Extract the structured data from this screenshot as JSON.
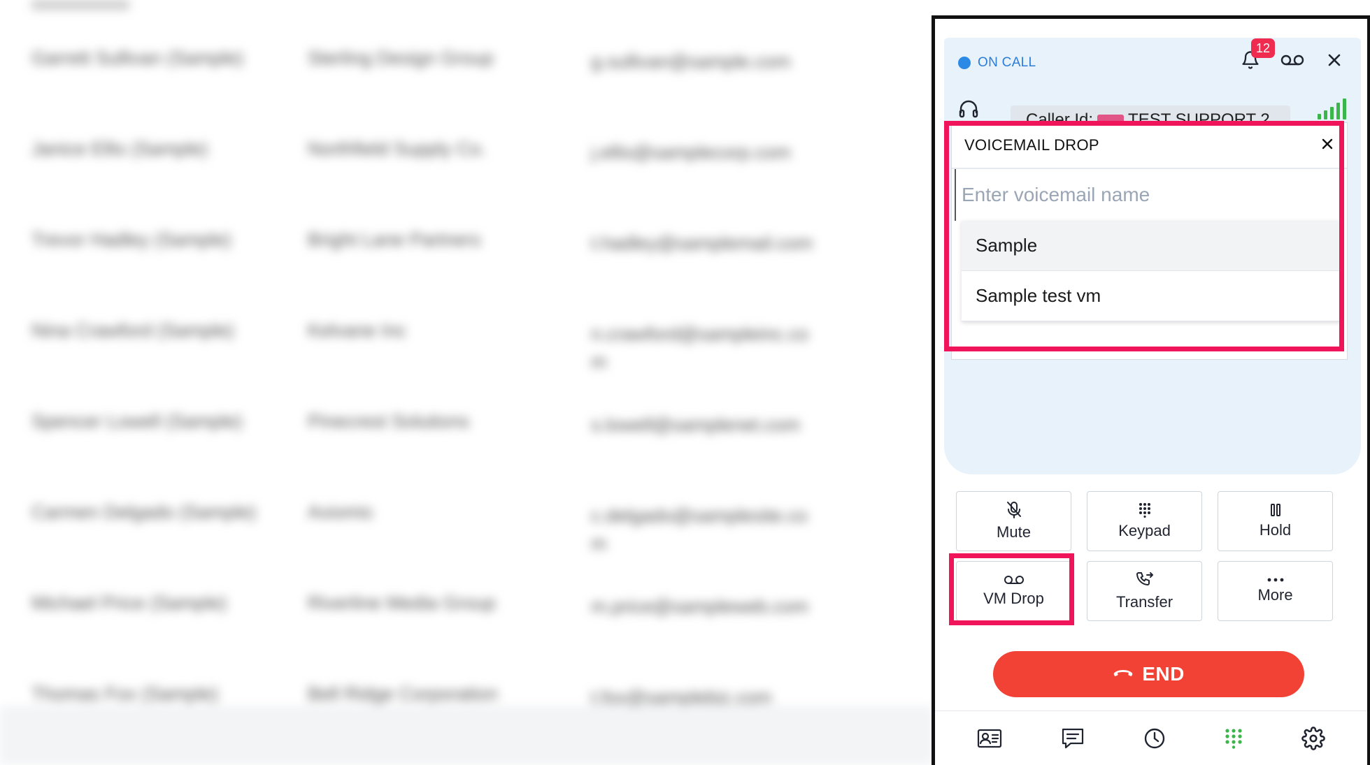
{
  "background": {
    "rows": [
      {
        "name": "Garrett Sullivan (Sample)",
        "company": "Sterling Design Group",
        "email": "g.sullivan@sample.com"
      },
      {
        "name": "Janice Ellis (Sample)",
        "company": "Northfield Supply Co.",
        "email": "j.ellis@samplecorp.com"
      },
      {
        "name": "Trevor Hadley (Sample)",
        "company": "Bright Lane Partners",
        "email": "t.hadley@samplemail.com"
      },
      {
        "name": "Nina Crawford (Sample)",
        "company": "Kelvane Inc",
        "email": "n.crawford@sampleinc.com"
      },
      {
        "name": "Spencer Lowell (Sample)",
        "company": "Pinecrest Solutions",
        "email": "s.lowell@samplenet.com"
      },
      {
        "name": "Carmen Delgado (Sample)",
        "company": "Axiomic",
        "email": "c.delgado@samplesite.com"
      },
      {
        "name": "Michael Price (Sample)",
        "company": "Riverline Media Group",
        "email": "m.price@sampleweb.com"
      },
      {
        "name": "Thomas Fox (Sample)",
        "company": "Bell Ridge Corporation",
        "email": "t.fox@samplebiz.com"
      }
    ]
  },
  "dialer": {
    "status": "ON CALL",
    "notifications_count": "12",
    "caller_id_label": "Caller Id:",
    "caller_name": "TEST SUPPORT 2",
    "voicemail_drop": {
      "title": "VOICEMAIL DROP",
      "input_placeholder": "Enter voicemail name",
      "options": [
        "Sample",
        "Sample test vm"
      ]
    },
    "actions": {
      "mute": "Mute",
      "keypad": "Keypad",
      "hold": "Hold",
      "vm_drop": "VM Drop",
      "transfer": "Transfer",
      "more": "More"
    },
    "end_label": "END",
    "colors": {
      "accent_blue": "#2b8ae6",
      "end_red": "#f24135",
      "highlight": "#f0145a",
      "signal_green": "#3cb54a"
    }
  }
}
